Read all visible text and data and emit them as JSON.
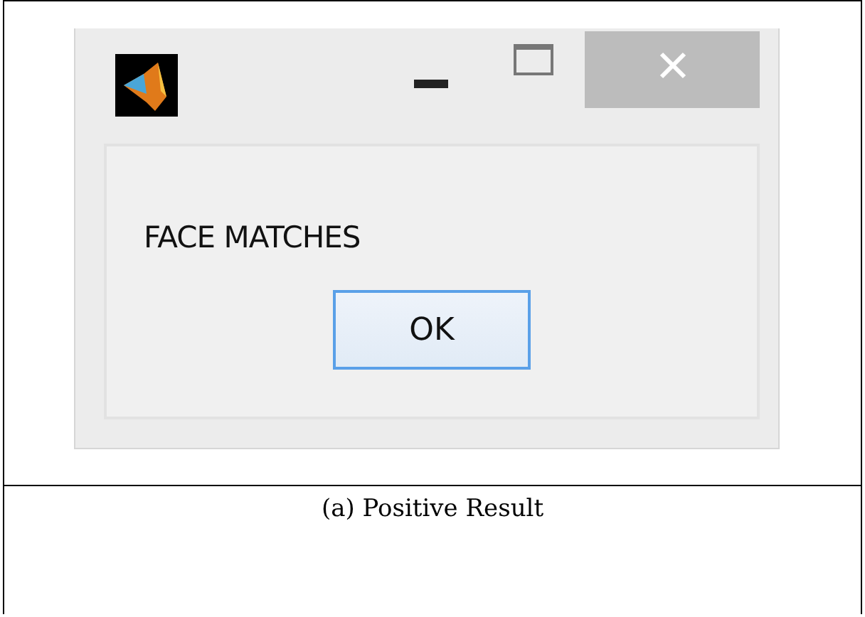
{
  "dialog": {
    "message": "FACE MATCHES",
    "buttons": [
      "OK"
    ]
  },
  "caption": "(a) Positive Result"
}
